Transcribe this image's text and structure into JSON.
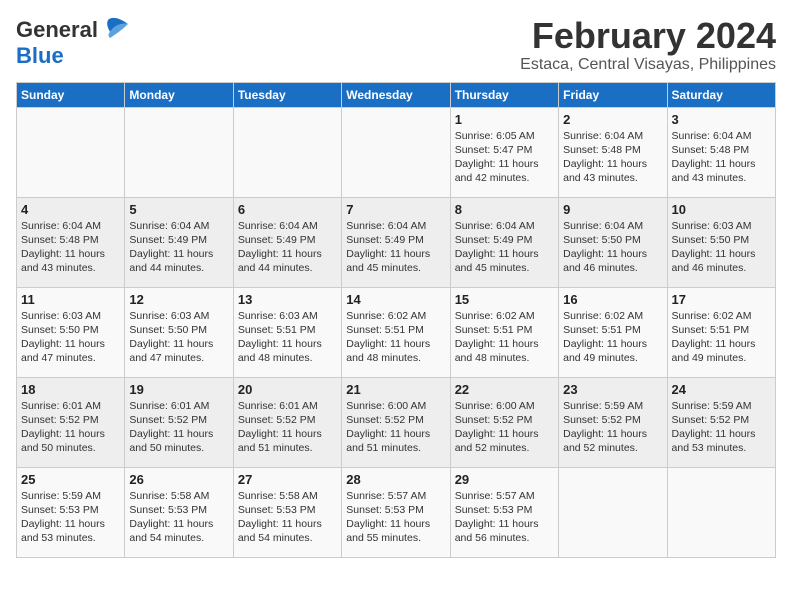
{
  "logo": {
    "line1_general": "General",
    "line2_blue": "Blue",
    "bird_unicode": "▶"
  },
  "header": {
    "month_year": "February 2024",
    "location": "Estaca, Central Visayas, Philippines"
  },
  "weekdays": [
    "Sunday",
    "Monday",
    "Tuesday",
    "Wednesday",
    "Thursday",
    "Friday",
    "Saturday"
  ],
  "weeks": [
    [
      {
        "day": "",
        "info": ""
      },
      {
        "day": "",
        "info": ""
      },
      {
        "day": "",
        "info": ""
      },
      {
        "day": "",
        "info": ""
      },
      {
        "day": "1",
        "info": "Sunrise: 6:05 AM\nSunset: 5:47 PM\nDaylight: 11 hours\nand 42 minutes."
      },
      {
        "day": "2",
        "info": "Sunrise: 6:04 AM\nSunset: 5:48 PM\nDaylight: 11 hours\nand 43 minutes."
      },
      {
        "day": "3",
        "info": "Sunrise: 6:04 AM\nSunset: 5:48 PM\nDaylight: 11 hours\nand 43 minutes."
      }
    ],
    [
      {
        "day": "4",
        "info": "Sunrise: 6:04 AM\nSunset: 5:48 PM\nDaylight: 11 hours\nand 43 minutes."
      },
      {
        "day": "5",
        "info": "Sunrise: 6:04 AM\nSunset: 5:49 PM\nDaylight: 11 hours\nand 44 minutes."
      },
      {
        "day": "6",
        "info": "Sunrise: 6:04 AM\nSunset: 5:49 PM\nDaylight: 11 hours\nand 44 minutes."
      },
      {
        "day": "7",
        "info": "Sunrise: 6:04 AM\nSunset: 5:49 PM\nDaylight: 11 hours\nand 45 minutes."
      },
      {
        "day": "8",
        "info": "Sunrise: 6:04 AM\nSunset: 5:49 PM\nDaylight: 11 hours\nand 45 minutes."
      },
      {
        "day": "9",
        "info": "Sunrise: 6:04 AM\nSunset: 5:50 PM\nDaylight: 11 hours\nand 46 minutes."
      },
      {
        "day": "10",
        "info": "Sunrise: 6:03 AM\nSunset: 5:50 PM\nDaylight: 11 hours\nand 46 minutes."
      }
    ],
    [
      {
        "day": "11",
        "info": "Sunrise: 6:03 AM\nSunset: 5:50 PM\nDaylight: 11 hours\nand 47 minutes."
      },
      {
        "day": "12",
        "info": "Sunrise: 6:03 AM\nSunset: 5:50 PM\nDaylight: 11 hours\nand 47 minutes."
      },
      {
        "day": "13",
        "info": "Sunrise: 6:03 AM\nSunset: 5:51 PM\nDaylight: 11 hours\nand 48 minutes."
      },
      {
        "day": "14",
        "info": "Sunrise: 6:02 AM\nSunset: 5:51 PM\nDaylight: 11 hours\nand 48 minutes."
      },
      {
        "day": "15",
        "info": "Sunrise: 6:02 AM\nSunset: 5:51 PM\nDaylight: 11 hours\nand 48 minutes."
      },
      {
        "day": "16",
        "info": "Sunrise: 6:02 AM\nSunset: 5:51 PM\nDaylight: 11 hours\nand 49 minutes."
      },
      {
        "day": "17",
        "info": "Sunrise: 6:02 AM\nSunset: 5:51 PM\nDaylight: 11 hours\nand 49 minutes."
      }
    ],
    [
      {
        "day": "18",
        "info": "Sunrise: 6:01 AM\nSunset: 5:52 PM\nDaylight: 11 hours\nand 50 minutes."
      },
      {
        "day": "19",
        "info": "Sunrise: 6:01 AM\nSunset: 5:52 PM\nDaylight: 11 hours\nand 50 minutes."
      },
      {
        "day": "20",
        "info": "Sunrise: 6:01 AM\nSunset: 5:52 PM\nDaylight: 11 hours\nand 51 minutes."
      },
      {
        "day": "21",
        "info": "Sunrise: 6:00 AM\nSunset: 5:52 PM\nDaylight: 11 hours\nand 51 minutes."
      },
      {
        "day": "22",
        "info": "Sunrise: 6:00 AM\nSunset: 5:52 PM\nDaylight: 11 hours\nand 52 minutes."
      },
      {
        "day": "23",
        "info": "Sunrise: 5:59 AM\nSunset: 5:52 PM\nDaylight: 11 hours\nand 52 minutes."
      },
      {
        "day": "24",
        "info": "Sunrise: 5:59 AM\nSunset: 5:52 PM\nDaylight: 11 hours\nand 53 minutes."
      }
    ],
    [
      {
        "day": "25",
        "info": "Sunrise: 5:59 AM\nSunset: 5:53 PM\nDaylight: 11 hours\nand 53 minutes."
      },
      {
        "day": "26",
        "info": "Sunrise: 5:58 AM\nSunset: 5:53 PM\nDaylight: 11 hours\nand 54 minutes."
      },
      {
        "day": "27",
        "info": "Sunrise: 5:58 AM\nSunset: 5:53 PM\nDaylight: 11 hours\nand 54 minutes."
      },
      {
        "day": "28",
        "info": "Sunrise: 5:57 AM\nSunset: 5:53 PM\nDaylight: 11 hours\nand 55 minutes."
      },
      {
        "day": "29",
        "info": "Sunrise: 5:57 AM\nSunset: 5:53 PM\nDaylight: 11 hours\nand 56 minutes."
      },
      {
        "day": "",
        "info": ""
      },
      {
        "day": "",
        "info": ""
      }
    ]
  ]
}
